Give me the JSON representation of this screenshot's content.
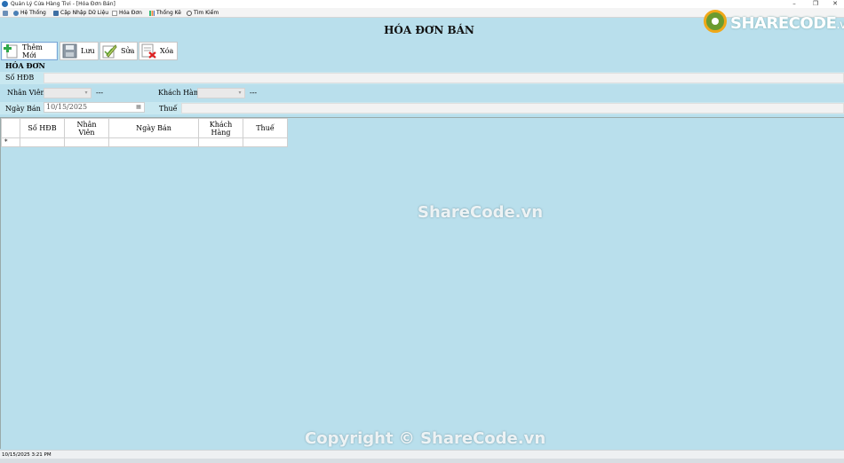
{
  "window": {
    "title": "Quản Lý Cửa Hàng Tivi - [Hóa Đơn Bán]",
    "minimize_glyph": "–",
    "restore_glyph": "❐",
    "close_glyph": "✕"
  },
  "menu": {
    "items": [
      {
        "label": "Hệ Thống",
        "icon": "system-icon"
      },
      {
        "label": "Cập Nhập Dữ Liệu",
        "icon": "update-data-icon"
      },
      {
        "label": "Hóa Đơn",
        "icon": "invoice-icon"
      },
      {
        "label": "Thống Kê",
        "icon": "statistics-icon"
      },
      {
        "label": "Tìm Kiếm",
        "icon": "search-icon"
      }
    ],
    "child_controls": "–  ❐  ✕"
  },
  "logo": {
    "main": "SHARECODE",
    "suffix": ".vn"
  },
  "header": {
    "title": "HÓA ĐƠN BÁN"
  },
  "toolbar": {
    "add_label": "Thêm Mới",
    "save_label": "Lưu",
    "edit_label": "Sửa",
    "delete_label": "Xóa"
  },
  "form": {
    "section_title": "HÓA ĐƠN",
    "invoice_no_label": "Số HĐB",
    "employee_label": "Nhân Viên",
    "employee_name": "---",
    "customer_label": "Khách Hàng",
    "customer_name": "---",
    "date_label": "Ngày Bán",
    "date_value": "10/15/2025",
    "tax_label": "Thuế"
  },
  "grid": {
    "columns": [
      {
        "line1": "Số HĐB",
        "line2": ""
      },
      {
        "line1": "Nhân",
        "line2": "Viên"
      },
      {
        "line1": "Ngày Bán",
        "line2": ""
      },
      {
        "line1": "Khách",
        "line2": "Hàng"
      },
      {
        "line1": "Thuế",
        "line2": ""
      }
    ],
    "new_row_marker": "*"
  },
  "watermarks": {
    "center": "ShareCode.vn",
    "bottom": "Copyright © ShareCode.vn"
  },
  "status": {
    "datetime": "10/15/2025   3:21 PM"
  },
  "colors": {
    "background": "#b9dfec",
    "accent_green": "#6a9b2f",
    "accent_orange": "#f0a818"
  }
}
